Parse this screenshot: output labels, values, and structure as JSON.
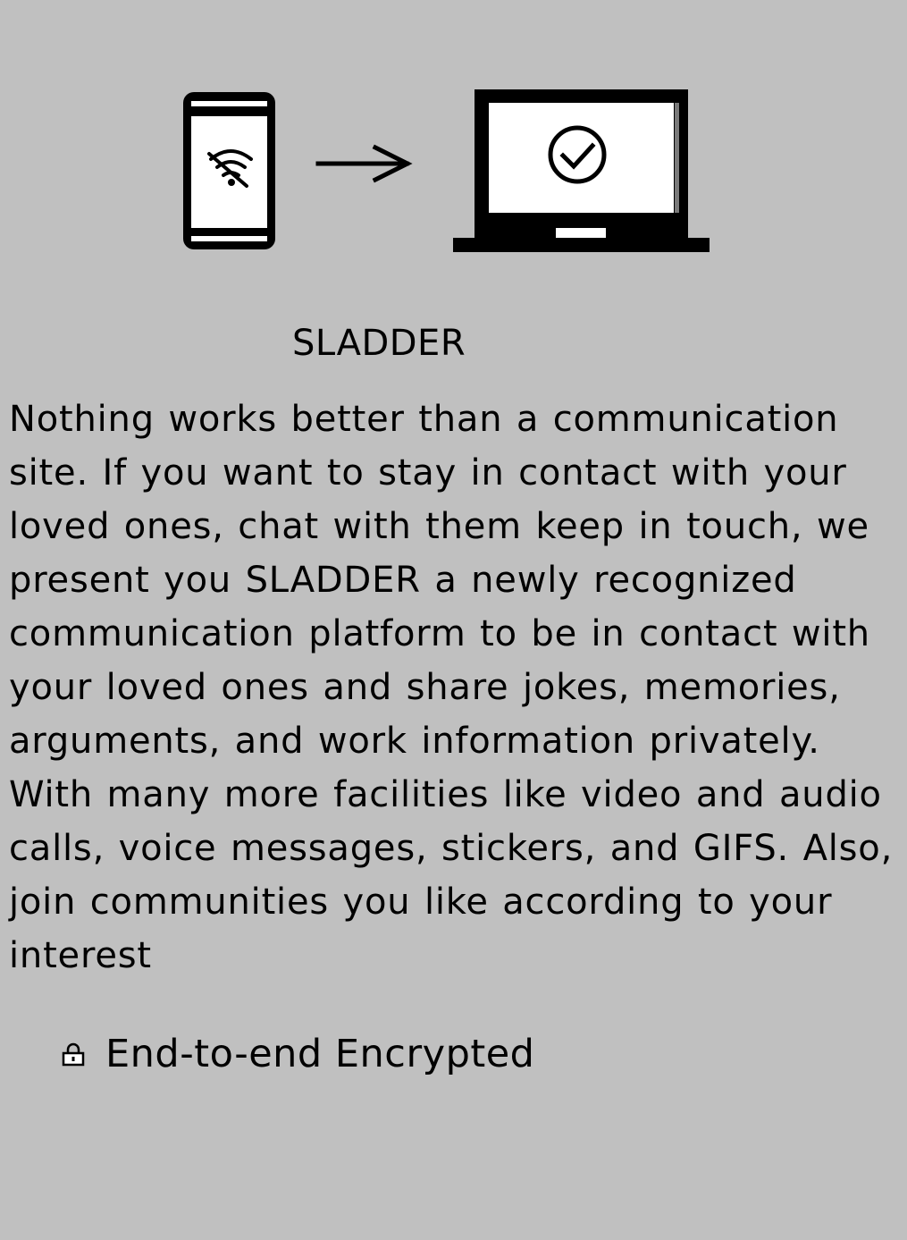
{
  "hero": {
    "phone_icon": "phone-no-wifi-icon",
    "arrow_icon": "arrow-right-icon",
    "laptop_icon": "laptop-check-icon"
  },
  "title": "SLADDER",
  "description": "Nothing works better than a communication site. If you want to stay in contact with your loved ones, chat with them keep in touch, we present you SLADDER a newly recognized communication platform to be in contact with your loved ones and share jokes, memories, arguments, and work information privately. With many more facilities like video and audio calls, voice messages, stickers, and GIFS. Also, join communities you like according to your interest",
  "feature": {
    "icon": "lock-icon",
    "label": "End-to-end Encrypted"
  },
  "colors": {
    "background": "#c0c0c0",
    "ink": "#000000",
    "screen": "#ffffff"
  }
}
